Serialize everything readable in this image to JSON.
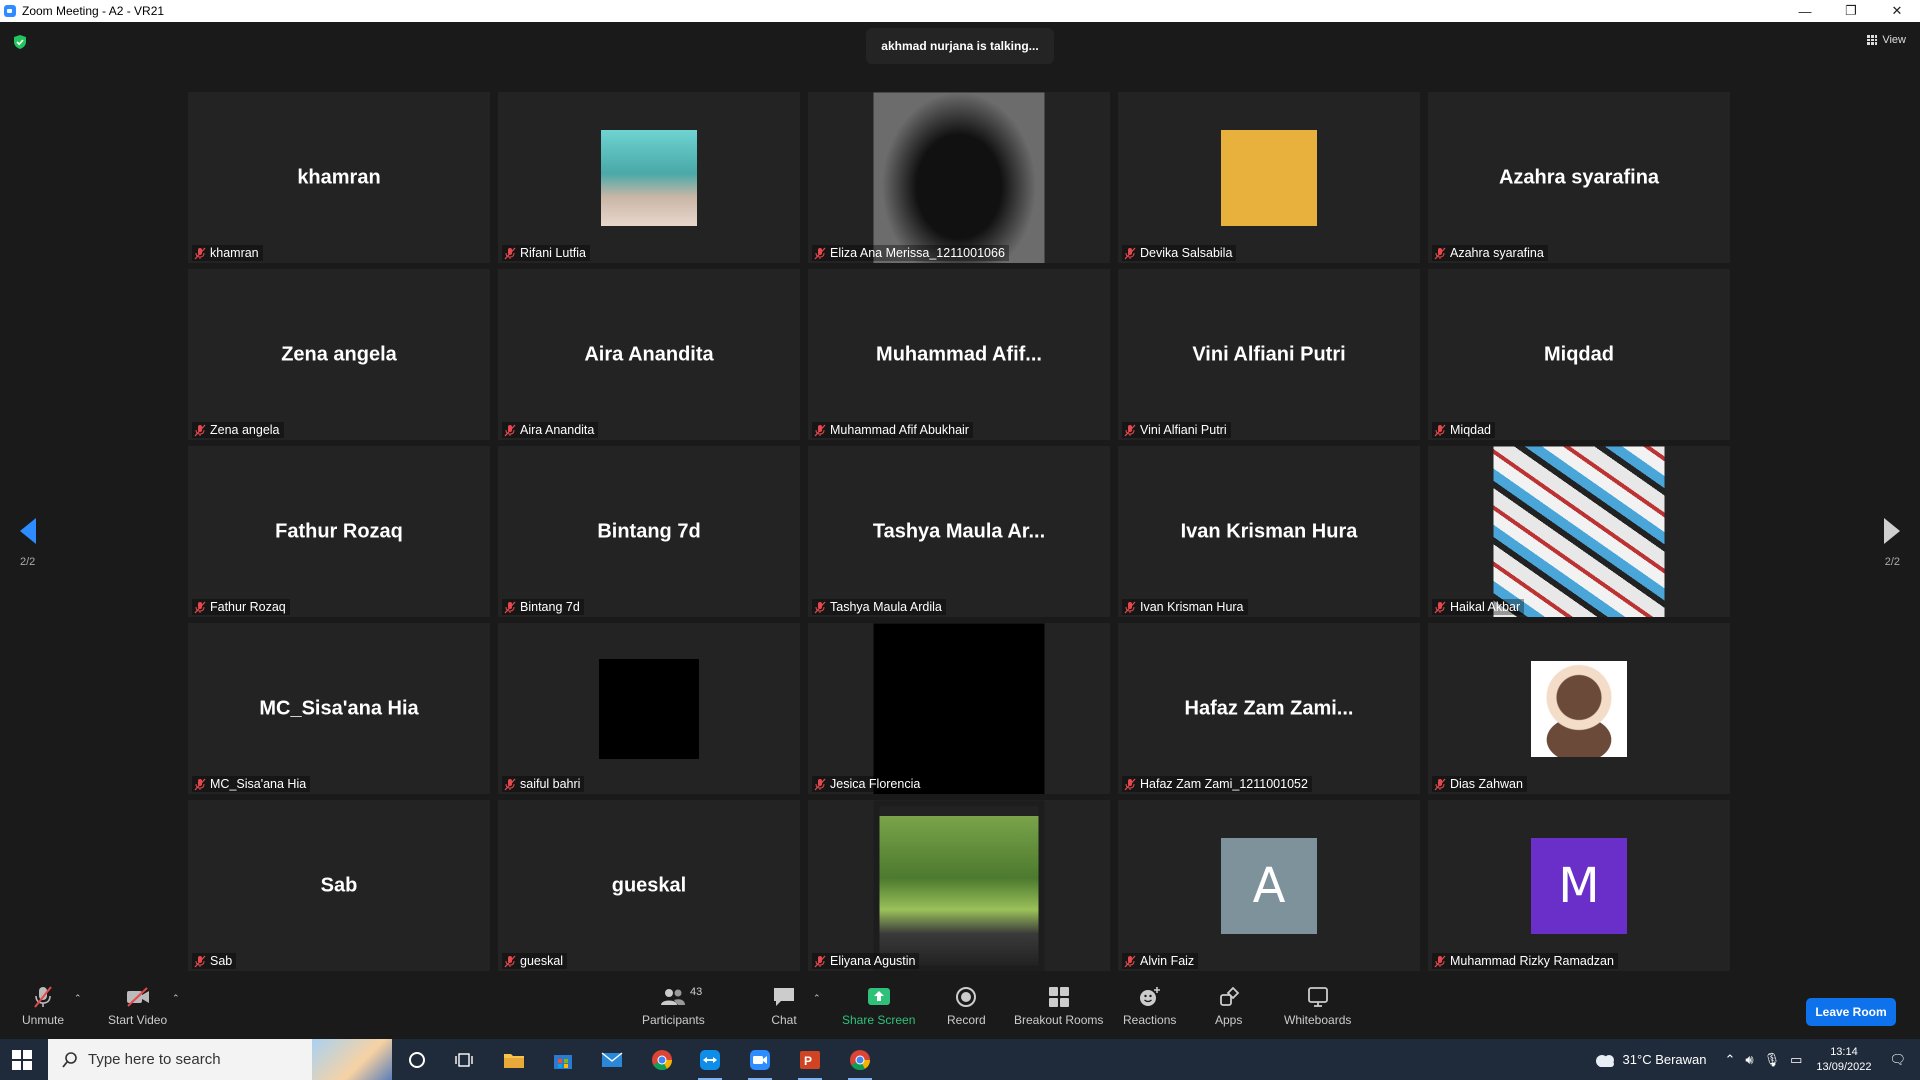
{
  "window": {
    "title": "Zoom Meeting - A2 - VR21",
    "controls": [
      "—",
      "❐",
      "✕"
    ]
  },
  "meeting": {
    "talking_indicator": "akhmad nurjana is talking...",
    "view_label": "View",
    "page_left": "2/2",
    "page_right": "2/2"
  },
  "participants": [
    {
      "display": "khamran",
      "label": "khamran",
      "kind": "name"
    },
    {
      "display": "",
      "label": "Rifani Lutfia",
      "kind": "photo"
    },
    {
      "display": "",
      "label": "Eliza Ana Merissa_1211001066",
      "kind": "video-dark"
    },
    {
      "display": "",
      "label": "Devika Salsabila",
      "kind": "photo-yellow"
    },
    {
      "display": "Azahra syarafina",
      "label": "Azahra syarafina",
      "kind": "name"
    },
    {
      "display": "Zena angela",
      "label": "Zena angela",
      "kind": "name"
    },
    {
      "display": "Aira Anandita",
      "label": "Aira Anandita",
      "kind": "name"
    },
    {
      "display": "Muhammad  Afif...",
      "label": "Muhammad Afif Abukhair",
      "kind": "name"
    },
    {
      "display": "Vini Alfiani Putri",
      "label": "Vini Alfiani Putri",
      "kind": "name"
    },
    {
      "display": "Miqdad",
      "label": "Miqdad",
      "kind": "name"
    },
    {
      "display": "Fathur Rozaq",
      "label": "Fathur Rozaq",
      "kind": "name"
    },
    {
      "display": "Bintang 7d",
      "label": "Bintang 7d",
      "kind": "name"
    },
    {
      "display": "Tashya  Maula  Ar...",
      "label": "Tashya Maula Ardila",
      "kind": "name"
    },
    {
      "display": "Ivan Krisman Hura",
      "label": "Ivan Krisman Hura",
      "kind": "name"
    },
    {
      "display": "",
      "label": "Haikal Akbar",
      "kind": "video-stickers"
    },
    {
      "display": "MC_Sisa'ana Hia",
      "label": "MC_Sisa'ana Hia",
      "kind": "name"
    },
    {
      "display": "",
      "label": "saiful bahri",
      "kind": "photo-black"
    },
    {
      "display": "",
      "label": "Jesica Florencia",
      "kind": "video-black"
    },
    {
      "display": "Hafaz Zam Zami...",
      "label": "Hafaz Zam Zami_1211001052",
      "kind": "name"
    },
    {
      "display": "",
      "label": "Dias Zahwan",
      "kind": "photo-cartoon"
    },
    {
      "display": "Sab",
      "label": "Sab",
      "kind": "name"
    },
    {
      "display": "gueskal",
      "label": "gueskal",
      "kind": "name"
    },
    {
      "display": "",
      "label": "Eliyana Agustin",
      "kind": "video-window"
    },
    {
      "display": "A",
      "label": "Alvin Faiz",
      "kind": "avatar-grey"
    },
    {
      "display": "M",
      "label": "Muhammad Rizky Ramadzan",
      "kind": "avatar-purple"
    }
  ],
  "toolbar": {
    "unmute": "Unmute",
    "start_video": "Start Video",
    "participants": "Participants",
    "participants_count": "43",
    "chat": "Chat",
    "share_screen": "Share Screen",
    "record": "Record",
    "breakout_rooms": "Breakout Rooms",
    "reactions": "Reactions",
    "apps": "Apps",
    "whiteboards": "Whiteboards",
    "leave_room": "Leave Room"
  },
  "taskbar": {
    "search_placeholder": "Type here to search",
    "weather": "31°C  Berawan",
    "time": "13:14",
    "date": "13/09/2022"
  },
  "colors": {
    "accent": "#0e72ed",
    "share_green": "#2fc17a",
    "mute_red": "#e5484d",
    "talking_bg": "#242424"
  }
}
